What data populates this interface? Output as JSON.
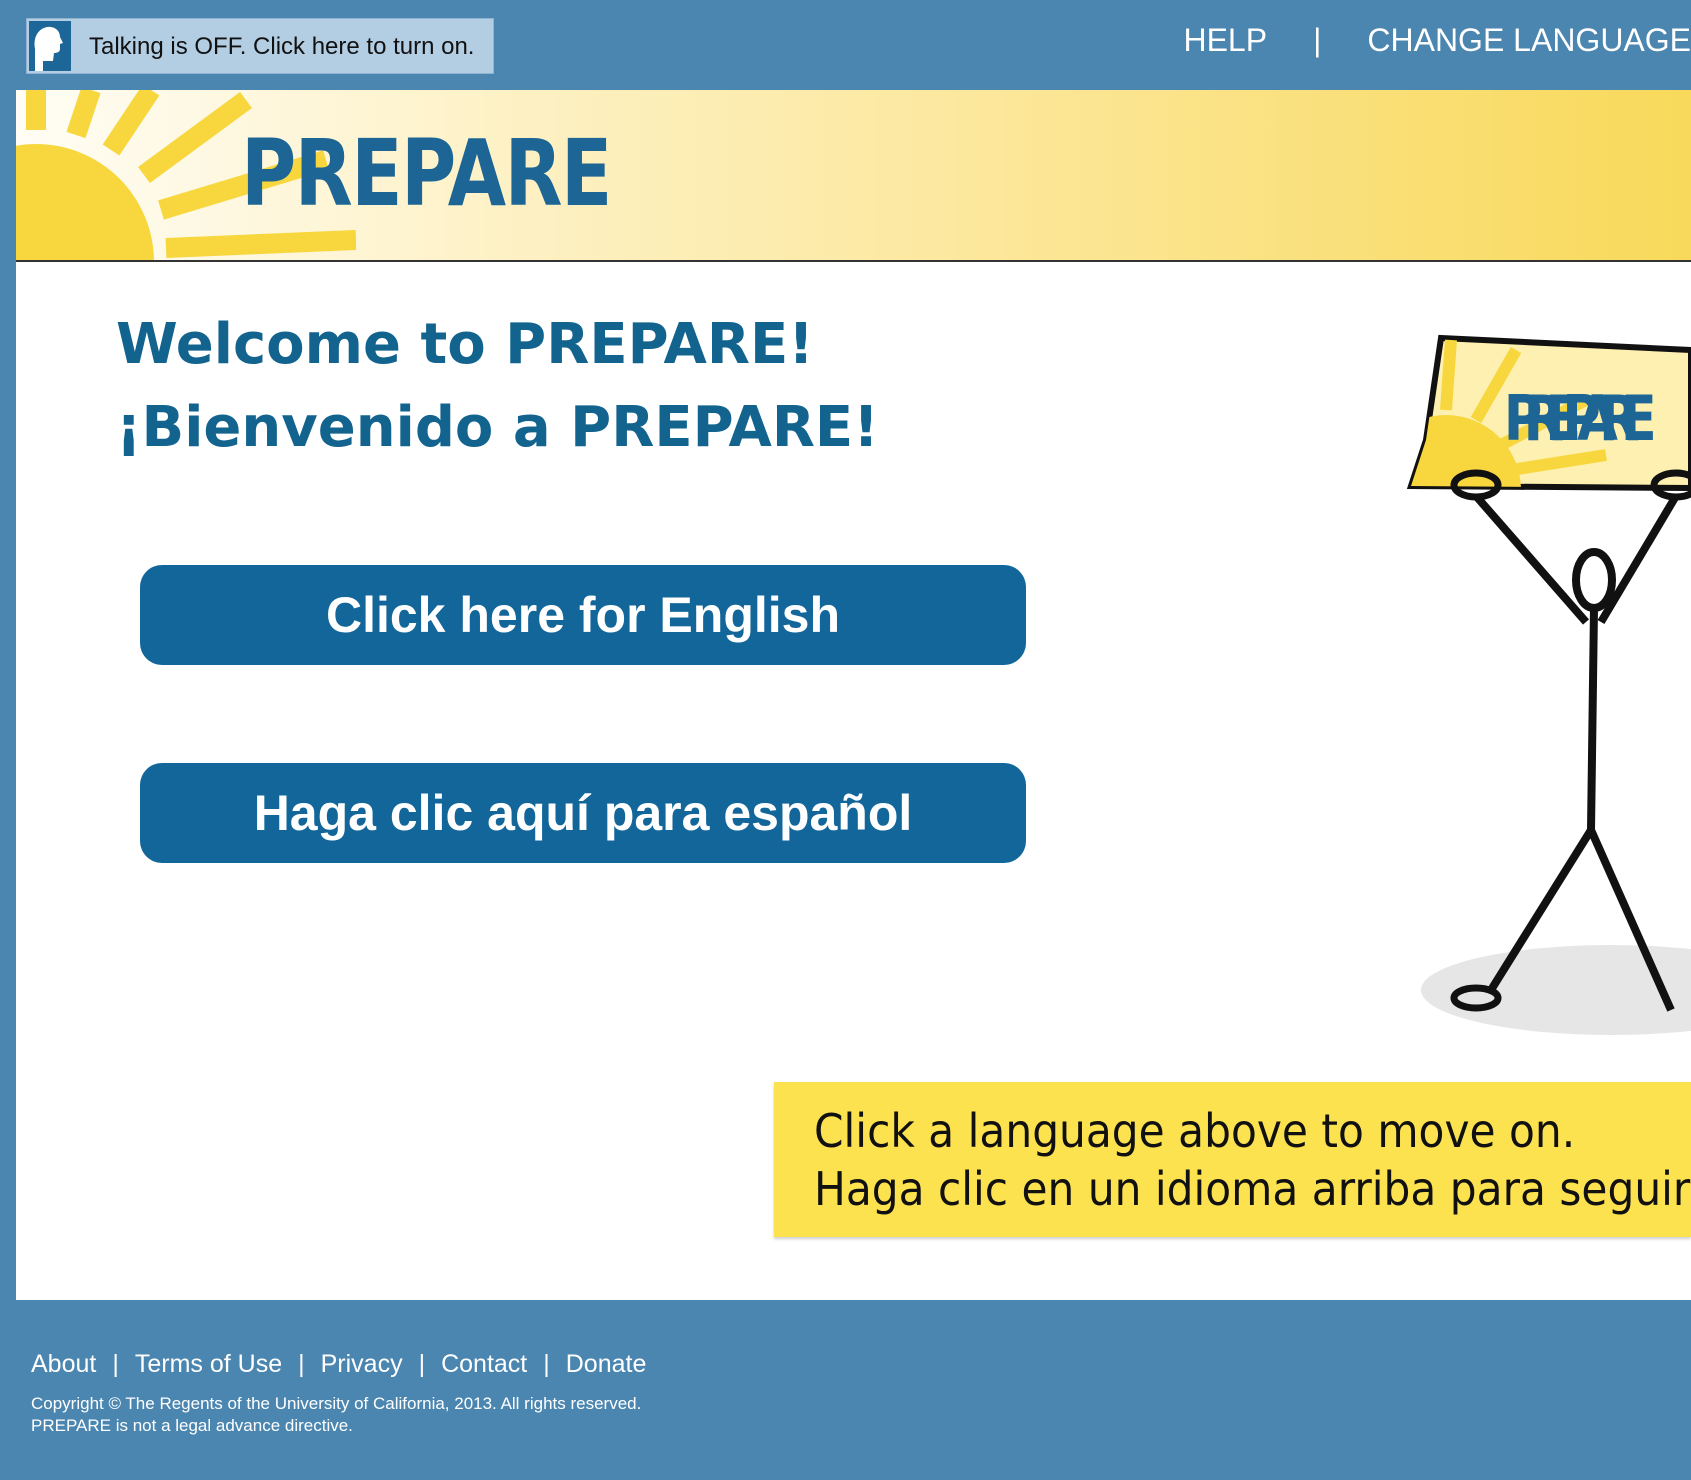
{
  "topbar": {
    "talking_label": "Talking is OFF. Click here to turn on.",
    "help": "HELP",
    "separator": "|",
    "change_language": "CHANGE LANGUAGE"
  },
  "banner": {
    "brand": "PREPARE"
  },
  "main": {
    "welcome_en": "Welcome to PREPARE!",
    "welcome_es": "¡Bienvenido a PREPARE!",
    "english_button": "Click here for English",
    "spanish_button": "Haga clic aquí para español",
    "sign_text": "PREPARE",
    "hint_line1": "Click a language above to move on.",
    "hint_line2": "Haga clic en un idioma arriba para seguir"
  },
  "footer": {
    "links": [
      "About",
      "Terms of Use",
      "Privacy",
      "Contact",
      "Donate"
    ],
    "separator": "|",
    "copyright": "Copyright © The Regents of the University of California, 2013. All rights reserved.",
    "disclaimer": "PREPARE is not a legal advance directive."
  },
  "colors": {
    "page_bg": "#4b86b0",
    "brand_blue": "#13669a",
    "hint_yellow": "#fde24f"
  }
}
